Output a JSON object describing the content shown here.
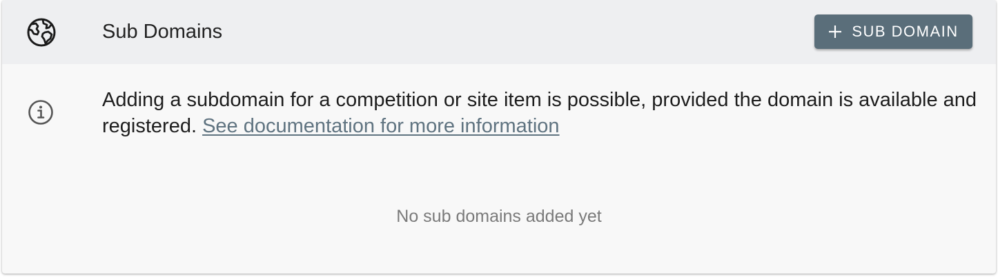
{
  "header": {
    "title": "Sub Domains",
    "icon": "globe-icon",
    "add_button_label": "SUB DOMAIN",
    "add_button_icon": "plus-icon"
  },
  "info": {
    "icon": "info-icon",
    "text": "Adding a subdomain for a competition or site item is possible, provided the domain is available and registered.",
    "link_text": "See documentation for more information"
  },
  "empty_state": {
    "text": "No sub domains added yet"
  },
  "colors": {
    "header_bg": "#eeeff1",
    "card_bg": "#f8f8f8",
    "button_bg": "#5a6e7a",
    "link": "#5f7380"
  }
}
